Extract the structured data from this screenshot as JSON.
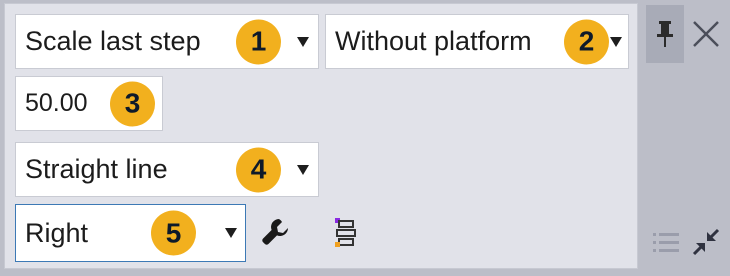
{
  "toolbar": {
    "row1": {
      "dropdown1": {
        "value": "Scale last step",
        "badge": "1"
      },
      "dropdown2": {
        "value": "Without platform",
        "badge": "2"
      }
    },
    "row2": {
      "numeric_input": {
        "value": "50.00",
        "badge": "3"
      }
    },
    "row3": {
      "dropdown3": {
        "value": "Straight line",
        "badge": "4"
      }
    },
    "row4": {
      "dropdown4": {
        "value": "Right",
        "badge": "5"
      },
      "icons": {
        "settings": "wrench-icon",
        "properties": "properties-tree-icon"
      }
    }
  },
  "side": {
    "pin": "pin-icon",
    "close": "close-icon",
    "list": "list-icon",
    "collapse": "collapse-icon"
  },
  "colors": {
    "badge": "#f2b01e",
    "panel": "#e1e2e9",
    "strip": "#bcbec8",
    "focus_border": "#3c79b5",
    "accent_purple": "#8a2be2",
    "accent_orange": "#f0a020"
  }
}
